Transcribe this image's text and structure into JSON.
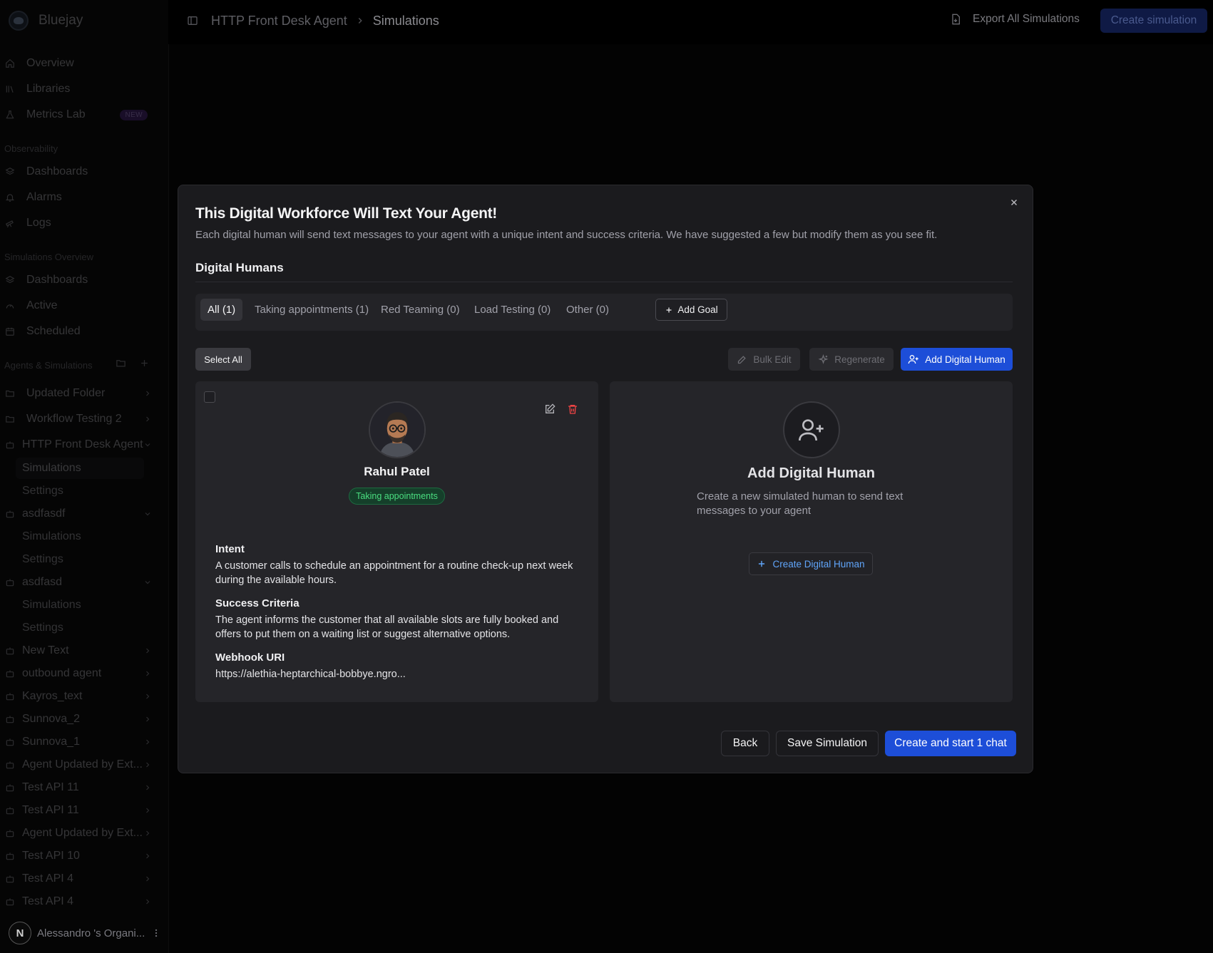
{
  "app": {
    "name": "Bluejay"
  },
  "header": {
    "breadcrumb": [
      "HTTP Front Desk Agent",
      "Simulations"
    ],
    "export_label": "Export All Simulations",
    "create_label": "Create simulation"
  },
  "sidebar": {
    "top": [
      {
        "label": "Overview",
        "icon": "home-icon"
      },
      {
        "label": "Libraries",
        "icon": "library-icon"
      },
      {
        "label": "Metrics Lab",
        "icon": "flask-icon",
        "badge": "NEW"
      }
    ],
    "observability": {
      "label": "Observability",
      "items": [
        {
          "label": "Dashboards",
          "icon": "layers-icon"
        },
        {
          "label": "Alarms",
          "icon": "bell-icon"
        },
        {
          "label": "Logs",
          "icon": "telescope-icon"
        }
      ]
    },
    "sim_overview": {
      "label": "Simulations Overview",
      "items": [
        {
          "label": "Dashboards",
          "icon": "layers-icon"
        },
        {
          "label": "Active",
          "icon": "gauge-icon"
        },
        {
          "label": "Scheduled",
          "icon": "calendar-icon"
        }
      ]
    },
    "agents_label": "Agents & Simulations",
    "folders": [
      "Updated Folder",
      "Workflow Testing 2"
    ],
    "agents": [
      {
        "label": "HTTP Front Desk Agent",
        "expanded": true,
        "subs": [
          "Simulations",
          "Settings"
        ]
      },
      {
        "label": "asdfasdf",
        "expanded": true,
        "subs": [
          "Simulations",
          "Settings"
        ]
      },
      {
        "label": "asdfasd",
        "expanded": true,
        "subs": [
          "Simulations",
          "Settings"
        ]
      },
      {
        "label": "New Text"
      },
      {
        "label": "outbound agent"
      },
      {
        "label": "Kayros_text"
      },
      {
        "label": "Sunnova_2"
      },
      {
        "label": "Sunnova_1"
      },
      {
        "label": "Agent Updated by Ext..."
      },
      {
        "label": "Test API 11"
      },
      {
        "label": "Test API 11"
      },
      {
        "label": "Agent Updated by Ext..."
      },
      {
        "label": "Test API 10"
      },
      {
        "label": "Test API 4"
      },
      {
        "label": "Test API 4"
      }
    ],
    "org": {
      "initial": "N",
      "name": "Alessandro 's Organi..."
    }
  },
  "modal": {
    "title": "This Digital Workforce Will Text Your Agent!",
    "description": "Each digital human will send text messages to your agent with a unique intent and success criteria. We have suggested a few but modify them as you see fit.",
    "section_title": "Digital Humans",
    "tabs": [
      {
        "label": "All (1)",
        "active": true
      },
      {
        "label": "Taking appointments (1)"
      },
      {
        "label": "Red Teaming (0)"
      },
      {
        "label": "Load Testing (0)"
      },
      {
        "label": "Other (0)"
      }
    ],
    "add_goal": "Add Goal",
    "select_all": "Select All",
    "bulk_edit": "Bulk Edit",
    "regenerate": "Regenerate",
    "add_digital_human": "Add Digital Human",
    "person": {
      "name": "Rahul Patel",
      "tag": "Taking appointments",
      "intent_label": "Intent",
      "intent": "A customer calls to schedule an appointment for a routine check-up next week during the available hours.",
      "success_label": "Success Criteria",
      "success": "The agent informs the customer that all available slots are fully booked and offers to put them on a waiting list or suggest alternative options.",
      "webhook_label": "Webhook URI",
      "webhook": "https://alethia-heptarchical-bobbye.ngro..."
    },
    "add_card": {
      "title": "Add Digital Human",
      "description": "Create a new simulated human to send text messages to your agent",
      "button": "Create Digital Human"
    },
    "footer": {
      "back": "Back",
      "save": "Save Simulation",
      "start": "Create and start 1 chat"
    }
  }
}
